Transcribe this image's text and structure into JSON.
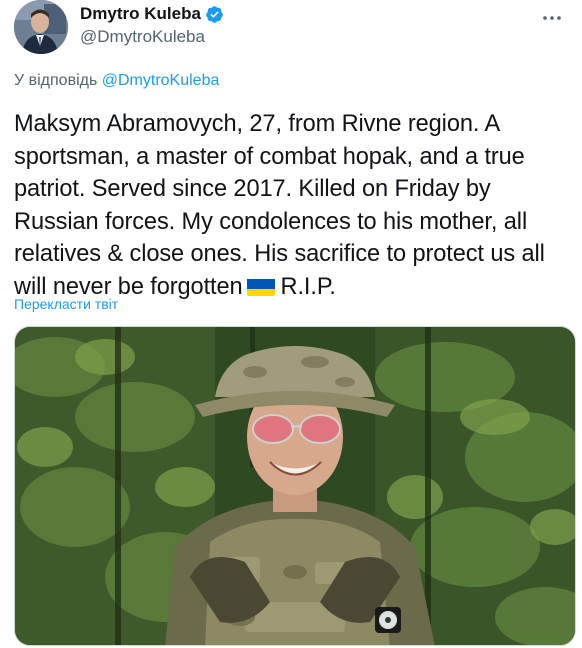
{
  "author": {
    "display_name": "Dmytro Kuleba",
    "handle": "@DmytroKuleba",
    "verified": true
  },
  "reply": {
    "prefix": "У відповідь",
    "target": "@DmytroKuleba"
  },
  "tweet": {
    "text_main": "Maksym Abramovych, 27, from Rivne region. A sportsman, a master of combat hopak, and a true patriot. Served since 2017. Killed on Friday by Russian forces. My condolences to his mother, all relatives & close ones. His sacrifice to protect us all will never be forgotten",
    "text_end": "R.I.P.",
    "emoji": "ukraine-flag"
  },
  "translate": {
    "label": "Перекласти твіт"
  },
  "colors": {
    "link": "#1d9bf0",
    "secondary_text": "#536471",
    "primary_text": "#0f1419",
    "flag_blue": "#0057b7",
    "flag_yellow": "#ffd700"
  },
  "icons": {
    "verified": "verified-badge-icon",
    "more": "more-options-icon"
  }
}
